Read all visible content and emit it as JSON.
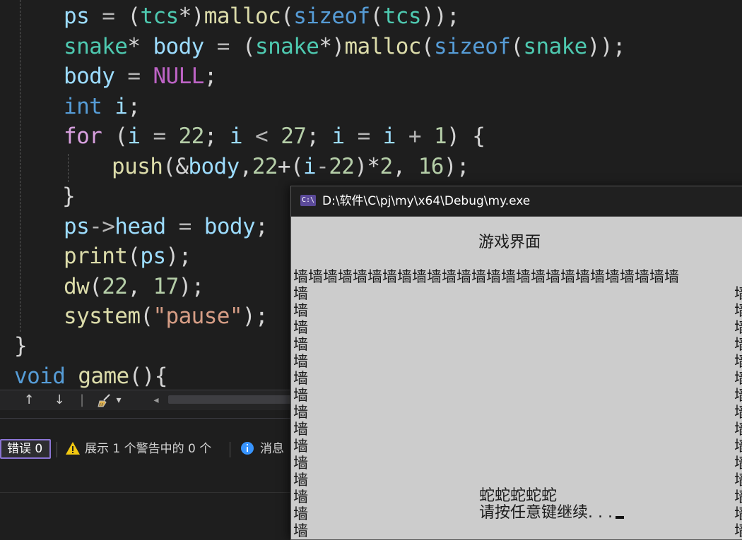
{
  "editor": {
    "lines": [
      [
        {
          "t": "ps",
          "c": "var"
        },
        {
          "t": " = ",
          "c": "op"
        },
        {
          "t": "(",
          "c": "pun"
        },
        {
          "t": "tcs",
          "c": "typ"
        },
        {
          "t": "*)",
          "c": "pun"
        },
        {
          "t": "malloc",
          "c": "fn"
        },
        {
          "t": "(",
          "c": "pun"
        },
        {
          "t": "sizeof",
          "c": "kw"
        },
        {
          "t": "(",
          "c": "pun"
        },
        {
          "t": "tcs",
          "c": "typ"
        },
        {
          "t": "));",
          "c": "pun"
        }
      ],
      [
        {
          "t": "snake",
          "c": "typ"
        },
        {
          "t": "* ",
          "c": "pun"
        },
        {
          "t": "body",
          "c": "var"
        },
        {
          "t": " = ",
          "c": "op"
        },
        {
          "t": "(",
          "c": "pun"
        },
        {
          "t": "snake",
          "c": "typ"
        },
        {
          "t": "*)",
          "c": "pun"
        },
        {
          "t": "malloc",
          "c": "fn"
        },
        {
          "t": "(",
          "c": "pun"
        },
        {
          "t": "sizeof",
          "c": "kw"
        },
        {
          "t": "(",
          "c": "pun"
        },
        {
          "t": "snake",
          "c": "typ"
        },
        {
          "t": "));",
          "c": "pun"
        }
      ],
      [
        {
          "t": "body",
          "c": "var"
        },
        {
          "t": " = ",
          "c": "op"
        },
        {
          "t": "NULL",
          "c": "mac"
        },
        {
          "t": ";",
          "c": "pun"
        }
      ],
      [
        {
          "t": "int",
          "c": "kw"
        },
        {
          "t": " ",
          "c": "pun"
        },
        {
          "t": "i",
          "c": "var"
        },
        {
          "t": ";",
          "c": "pun"
        }
      ],
      [
        {
          "t": "for",
          "c": "ctl"
        },
        {
          "t": " (",
          "c": "pun"
        },
        {
          "t": "i",
          "c": "var"
        },
        {
          "t": " = ",
          "c": "op"
        },
        {
          "t": "22",
          "c": "num"
        },
        {
          "t": "; ",
          "c": "pun"
        },
        {
          "t": "i",
          "c": "var"
        },
        {
          "t": " < ",
          "c": "op"
        },
        {
          "t": "27",
          "c": "num"
        },
        {
          "t": "; ",
          "c": "pun"
        },
        {
          "t": "i",
          "c": "var"
        },
        {
          "t": " = ",
          "c": "op"
        },
        {
          "t": "i",
          "c": "var"
        },
        {
          "t": " + ",
          "c": "op"
        },
        {
          "t": "1",
          "c": "num"
        },
        {
          "t": ") {",
          "c": "pun"
        }
      ],
      [
        {
          "t": "push",
          "c": "fn"
        },
        {
          "t": "(&",
          "c": "pun"
        },
        {
          "t": "body",
          "c": "var"
        },
        {
          "t": ",",
          "c": "pun"
        },
        {
          "t": "22",
          "c": "num"
        },
        {
          "t": "+(",
          "c": "pun"
        },
        {
          "t": "i",
          "c": "var"
        },
        {
          "t": "-",
          "c": "op"
        },
        {
          "t": "22",
          "c": "num"
        },
        {
          "t": ")*",
          "c": "pun"
        },
        {
          "t": "2",
          "c": "num"
        },
        {
          "t": ", ",
          "c": "pun"
        },
        {
          "t": "16",
          "c": "num"
        },
        {
          "t": ");",
          "c": "pun"
        }
      ],
      [
        {
          "t": "}",
          "c": "pun"
        }
      ],
      [
        {
          "t": "ps",
          "c": "var"
        },
        {
          "t": "->",
          "c": "op"
        },
        {
          "t": "head",
          "c": "var"
        },
        {
          "t": " = ",
          "c": "op"
        },
        {
          "t": "body",
          "c": "var"
        },
        {
          "t": ";",
          "c": "pun"
        }
      ],
      [
        {
          "t": "print",
          "c": "fn"
        },
        {
          "t": "(",
          "c": "pun"
        },
        {
          "t": "ps",
          "c": "var"
        },
        {
          "t": ");",
          "c": "pun"
        }
      ],
      [
        {
          "t": "dw",
          "c": "fn"
        },
        {
          "t": "(",
          "c": "pun"
        },
        {
          "t": "22",
          "c": "num"
        },
        {
          "t": ", ",
          "c": "pun"
        },
        {
          "t": "17",
          "c": "num"
        },
        {
          "t": ");",
          "c": "pun"
        }
      ],
      [
        {
          "t": "system",
          "c": "fn"
        },
        {
          "t": "(",
          "c": "pun"
        },
        {
          "t": "\"pause\"",
          "c": "str"
        },
        {
          "t": ");",
          "c": "pun"
        }
      ],
      [
        {
          "t": "}",
          "c": "pun"
        }
      ],
      [
        {
          "t": "void",
          "c": "kw"
        },
        {
          "t": " ",
          "c": "pun"
        },
        {
          "t": "game",
          "c": "fn"
        },
        {
          "t": "(){",
          "c": "pun"
        }
      ]
    ]
  },
  "nav_bar": {
    "up_arrow": "↑",
    "down_arrow": "↓",
    "separator": "|",
    "cleanup_icon": "broom-icon",
    "dropdown_icon": "▾",
    "scroll_left": "◂"
  },
  "error_list": {
    "errors_label": "错误 0",
    "warnings_label": "展示 1 个警告中的 0 个",
    "messages_label": "消息"
  },
  "console": {
    "title": "D:\\软件\\C\\pj\\my\\x64\\Debug\\my.exe",
    "icon_label": "C:\\",
    "header_text": "游戏界面",
    "wall_char": "墙",
    "wall_top_count": 26,
    "wall_rows": 15,
    "snake_text": "蛇蛇蛇蛇蛇",
    "pause_text": "请按任意键继续. . ."
  },
  "colors": {
    "editor_bg": "#1e1e1e",
    "console_bg": "#cccccc",
    "console_titlebar": "#202020",
    "error_filter_border": "#8b74d4",
    "warning_yellow": "#f2c811",
    "info_blue": "#3794ff"
  }
}
